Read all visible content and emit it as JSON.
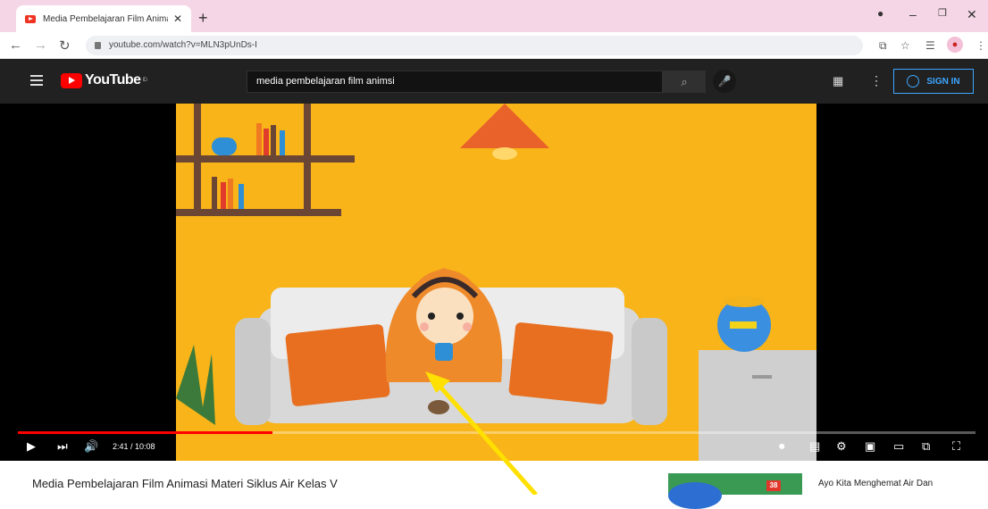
{
  "browser": {
    "tab_title": "Media Pembelajaran Film Animasi",
    "tab_close": "✕",
    "new_tab": "+",
    "url": "youtube.com/watch?v=MLN3pUnDs-I"
  },
  "youtube": {
    "logo_text": "YouTube",
    "logo_sup": "ID",
    "search_query": "media pembelajaran film animsi",
    "signin_label": "SIGN IN"
  },
  "player": {
    "time": "2:41 / 10:08",
    "progress": 0.266
  },
  "video": {
    "title": "Media Pembelajaran Film Animasi Materi Siklus Air Kelas V"
  },
  "recommendation": {
    "badge": "38",
    "title": "Ayo Kita Menghemat Air Dan"
  },
  "colors": {
    "accent": "#ff0000",
    "sign_in": "#3ea6ff",
    "scene_bg": "#f8b418",
    "hijab": "#ef8a2a",
    "sofa": "#d8d8d8"
  }
}
